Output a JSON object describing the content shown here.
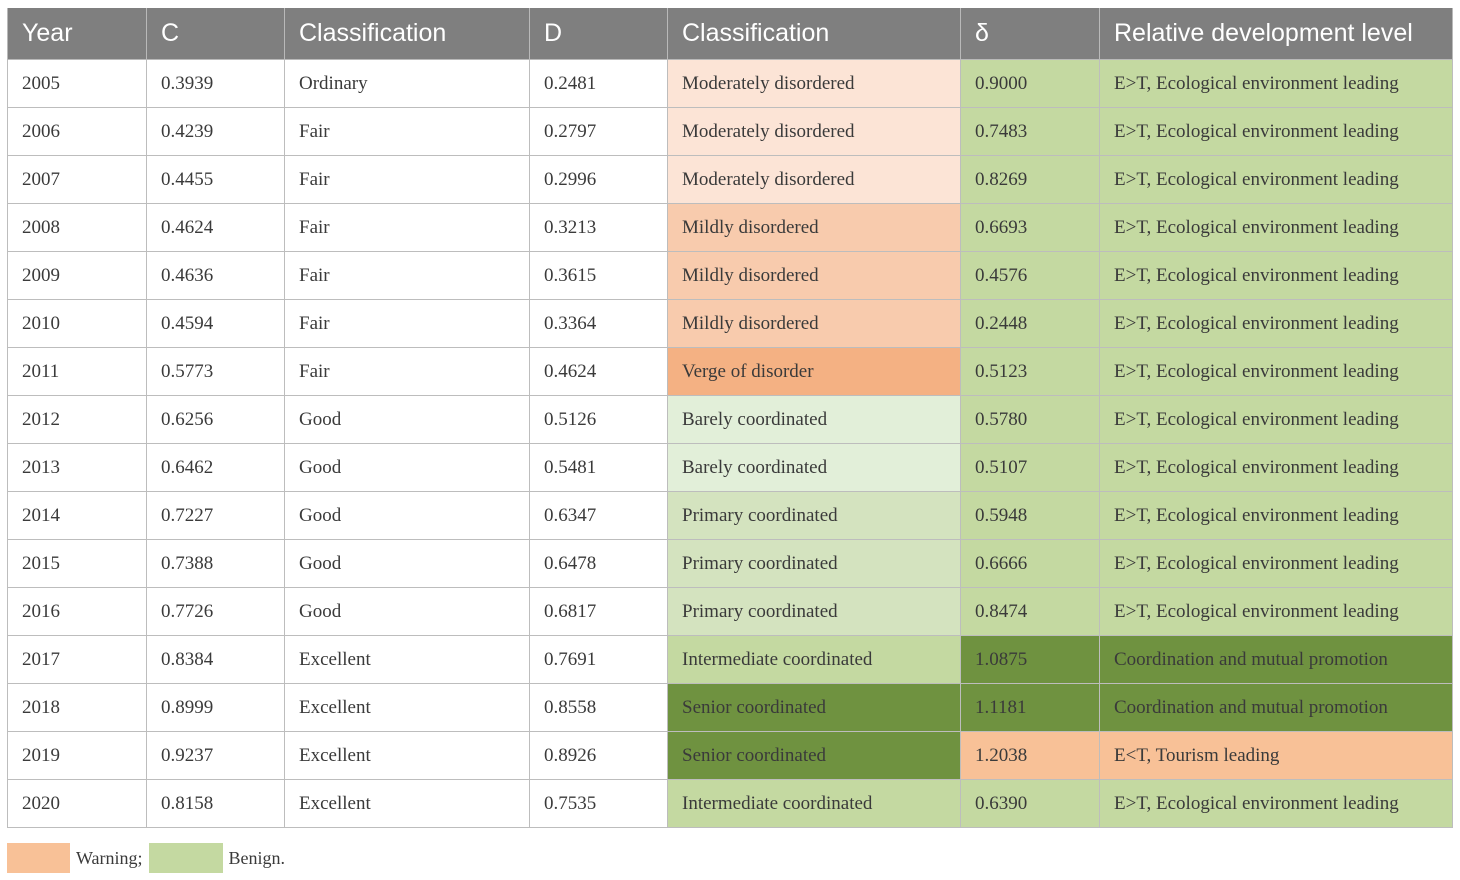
{
  "headers": [
    "Year",
    "C",
    "Classification",
    "D",
    "Classification",
    "δ",
    "Relative development level"
  ],
  "colors": {
    "header_bg": "#7f7f7f",
    "moderately_disordered": "#fce4d6",
    "mildly_disordered": "#f8cbad",
    "verge_of_disorder": "#f4b183",
    "barely_coordinated": "#e2efd9",
    "primary_coordinated": "#d4e3bf",
    "intermediate_coordinated": "#c4d9a1",
    "senior_coordinated": "#6f9240",
    "delta_normal": "#c4d9a1",
    "delta_dark": "#6f9240",
    "delta_warning": "#f8c197"
  },
  "rows": [
    {
      "year": "2005",
      "c": "0.3939",
      "class1": "Ordinary",
      "d": "0.2481",
      "class2": "Moderately disordered",
      "delta": "0.9000",
      "rel": "E>T, Ecological environment leading",
      "class2_bg": "#fce4d6",
      "delta_bg": "#c4d9a1",
      "rel_bg": "#c4d9a1"
    },
    {
      "year": "2006",
      "c": "0.4239",
      "class1": "Fair",
      "d": "0.2797",
      "class2": "Moderately disordered",
      "delta": "0.7483",
      "rel": "E>T, Ecological environment leading",
      "class2_bg": "#fce4d6",
      "delta_bg": "#c4d9a1",
      "rel_bg": "#c4d9a1"
    },
    {
      "year": "2007",
      "c": "0.4455",
      "class1": "Fair",
      "d": "0.2996",
      "class2": "Moderately disordered",
      "delta": "0.8269",
      "rel": "E>T, Ecological environment leading",
      "class2_bg": "#fce4d6",
      "delta_bg": "#c4d9a1",
      "rel_bg": "#c4d9a1"
    },
    {
      "year": "2008",
      "c": "0.4624",
      "class1": "Fair",
      "d": "0.3213",
      "class2": "Mildly disordered",
      "delta": "0.6693",
      "rel": "E>T, Ecological environment leading",
      "class2_bg": "#f8cbad",
      "delta_bg": "#c4d9a1",
      "rel_bg": "#c4d9a1"
    },
    {
      "year": "2009",
      "c": "0.4636",
      "class1": "Fair",
      "d": "0.3615",
      "class2": "Mildly disordered",
      "delta": "0.4576",
      "rel": "E>T, Ecological environment leading",
      "class2_bg": "#f8cbad",
      "delta_bg": "#c4d9a1",
      "rel_bg": "#c4d9a1"
    },
    {
      "year": "2010",
      "c": "0.4594",
      "class1": "Fair",
      "d": "0.3364",
      "class2": "Mildly disordered",
      "delta": "0.2448",
      "rel": "E>T, Ecological environment leading",
      "class2_bg": "#f8cbad",
      "delta_bg": "#c4d9a1",
      "rel_bg": "#c4d9a1"
    },
    {
      "year": "2011",
      "c": "0.5773",
      "class1": "Fair",
      "d": "0.4624",
      "class2": "Verge of disorder",
      "delta": "0.5123",
      "rel": "E>T, Ecological environment leading",
      "class2_bg": "#f4b183",
      "delta_bg": "#c4d9a1",
      "rel_bg": "#c4d9a1"
    },
    {
      "year": "2012",
      "c": "0.6256",
      "class1": "Good",
      "d": "0.5126",
      "class2": "Barely coordinated",
      "delta": "0.5780",
      "rel": "E>T, Ecological environment leading",
      "class2_bg": "#e2efd9",
      "delta_bg": "#c4d9a1",
      "rel_bg": "#c4d9a1"
    },
    {
      "year": "2013",
      "c": "0.6462",
      "class1": "Good",
      "d": "0.5481",
      "class2": "Barely coordinated",
      "delta": "0.5107",
      "rel": "E>T, Ecological environment leading",
      "class2_bg": "#e2efd9",
      "delta_bg": "#c4d9a1",
      "rel_bg": "#c4d9a1"
    },
    {
      "year": "2014",
      "c": "0.7227",
      "class1": "Good",
      "d": "0.6347",
      "class2": "Primary coordinated",
      "delta": "0.5948",
      "rel": "E>T, Ecological environment leading",
      "class2_bg": "#d4e3bf",
      "delta_bg": "#c4d9a1",
      "rel_bg": "#c4d9a1"
    },
    {
      "year": "2015",
      "c": "0.7388",
      "class1": "Good",
      "d": "0.6478",
      "class2": "Primary coordinated",
      "delta": "0.6666",
      "rel": "E>T, Ecological environment leading",
      "class2_bg": "#d4e3bf",
      "delta_bg": "#c4d9a1",
      "rel_bg": "#c4d9a1"
    },
    {
      "year": "2016",
      "c": "0.7726",
      "class1": "Good",
      "d": "0.6817",
      "class2": "Primary coordinated",
      "delta": "0.8474",
      "rel": "E>T, Ecological environment leading",
      "class2_bg": "#d4e3bf",
      "delta_bg": "#c4d9a1",
      "rel_bg": "#c4d9a1"
    },
    {
      "year": "2017",
      "c": "0.8384",
      "class1": "Excellent",
      "d": "0.7691",
      "class2": "Intermediate coordinated",
      "delta": "1.0875",
      "rel": "Coordination and mutual promotion",
      "class2_bg": "#c4d9a1",
      "delta_bg": "#6f9240",
      "rel_bg": "#6f9240"
    },
    {
      "year": "2018",
      "c": "0.8999",
      "class1": "Excellent",
      "d": "0.8558",
      "class2": "Senior coordinated",
      "delta": "1.1181",
      "rel": "Coordination and mutual promotion",
      "class2_bg": "#6f9240",
      "delta_bg": "#6f9240",
      "rel_bg": "#6f9240"
    },
    {
      "year": "2019",
      "c": "0.9237",
      "class1": "Excellent",
      "d": "0.8926",
      "class2": "Senior coordinated",
      "delta": "1.2038",
      "rel": "E<T, Tourism leading",
      "class2_bg": "#6f9240",
      "delta_bg": "#f8c197",
      "rel_bg": "#f8c197"
    },
    {
      "year": "2020",
      "c": "0.8158",
      "class1": "Excellent",
      "d": "0.7535",
      "class2": "Intermediate coordinated",
      "delta": "0.6390",
      "rel": "E>T, Ecological environment leading",
      "class2_bg": "#c4d9a1",
      "delta_bg": "#c4d9a1",
      "rel_bg": "#c4d9a1"
    }
  ],
  "legend": {
    "warning_label": "Warning;",
    "warning_color": "#f8c197",
    "benign_label": "Benign.",
    "benign_color": "#c4d9a1"
  }
}
